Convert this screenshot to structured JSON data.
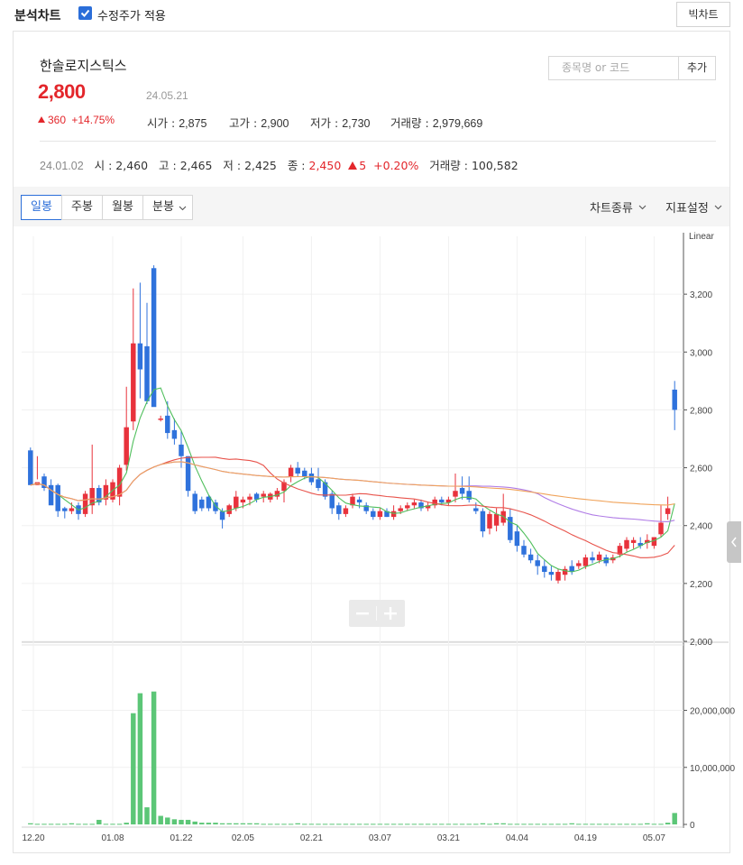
{
  "topbar": {
    "title": "분석차트",
    "adjusted_checkbox_label": "수정주가 적용",
    "adjusted_checked": true,
    "big_chart_button": "빅차트"
  },
  "stock": {
    "name": "한솔로지스틱스",
    "price": "2,800",
    "date": "24.05.21",
    "change": "360",
    "change_pct": "+14.75%",
    "open_label": "시가",
    "open": "2,875",
    "high_label": "고가",
    "high": "2,900",
    "low_label": "저가",
    "low": "2,730",
    "volume_label": "거래량",
    "volume": "2,979,669"
  },
  "search": {
    "placeholder": "종목명 or 코드",
    "add_button": "추가"
  },
  "hover": {
    "date": "24.01.02",
    "open_label": "시",
    "open": "2,460",
    "high_label": "고",
    "high": "2,465",
    "low_label": "저",
    "low": "2,425",
    "close_label": "종",
    "close": "2,450",
    "change": "5",
    "change_pct": "+0.20%",
    "volume_label": "거래량",
    "volume": "100,582"
  },
  "toolbar": {
    "periods": [
      "일봉",
      "주봉",
      "월봉",
      "분봉"
    ],
    "active_period": "일봉",
    "chart_type": "차트종류",
    "indicator_settings": "지표설정"
  },
  "colors": {
    "up": "#e8323c",
    "down": "#2f72dc",
    "volume": "#5cc677",
    "ma5": "#4fbf5c",
    "ma20": "#e8534b",
    "ma60": "#b07ce6",
    "ma120": "#f0a35a"
  },
  "chart_data": {
    "type": "candlestick",
    "scale_label": "Linear",
    "price_ticks": [
      2000,
      2200,
      2400,
      2600,
      2800,
      3000,
      3200
    ],
    "price_tick_labels": [
      "2,000",
      "2,200",
      "2,400",
      "2,600",
      "2,800",
      "3,000",
      "3,200"
    ],
    "volume_tick_labels": [
      "0",
      "10,000,000",
      "20,000,000"
    ],
    "volume_ticks": [
      0,
      10000000,
      20000000
    ],
    "x_tick_labels": [
      "12.20",
      "01.08",
      "01.22",
      "02.05",
      "02.21",
      "03.07",
      "03.21",
      "04.04",
      "04.19",
      "05.07"
    ],
    "candles": [
      [
        2660,
        2670,
        2560,
        2540
      ],
      [
        2540,
        2640,
        2560,
        2550
      ],
      [
        2570,
        2580,
        2520,
        2530
      ],
      [
        2540,
        2560,
        2530,
        2470
      ],
      [
        2540,
        2545,
        2430,
        2450
      ],
      [
        2460,
        2465,
        2425,
        2450
      ],
      [
        2450,
        2480,
        2440,
        2460
      ],
      [
        2470,
        2480,
        2420,
        2440
      ],
      [
        2440,
        2520,
        2430,
        2510
      ],
      [
        2470,
        2680,
        2440,
        2530
      ],
      [
        2530,
        2540,
        2470,
        2480
      ],
      [
        2490,
        2560,
        2470,
        2540
      ],
      [
        2490,
        2560,
        2480,
        2550
      ],
      [
        2500,
        2610,
        2470,
        2600
      ],
      [
        2610,
        2880,
        2590,
        2740
      ],
      [
        2760,
        3220,
        2730,
        3030
      ],
      [
        3030,
        3240,
        2840,
        2940
      ],
      [
        3020,
        3170,
        2820,
        2830
      ],
      [
        3290,
        3300,
        2870,
        2810
      ],
      [
        2770,
        2780,
        2760,
        2770
      ],
      [
        2780,
        2830,
        2700,
        2720
      ],
      [
        2730,
        2770,
        2680,
        2700
      ],
      [
        2680,
        2730,
        2600,
        2640
      ],
      [
        2640,
        2640,
        2500,
        2520
      ],
      [
        2510,
        2520,
        2440,
        2450
      ],
      [
        2490,
        2500,
        2450,
        2460
      ],
      [
        2500,
        2505,
        2450,
        2460
      ],
      [
        2480,
        2490,
        2440,
        2450
      ],
      [
        2450,
        2460,
        2390,
        2420
      ],
      [
        2440,
        2475,
        2430,
        2470
      ],
      [
        2460,
        2520,
        2450,
        2500
      ],
      [
        2480,
        2500,
        2460,
        2490
      ],
      [
        2490,
        2510,
        2470,
        2500
      ],
      [
        2510,
        2515,
        2480,
        2490
      ],
      [
        2500,
        2520,
        2480,
        2510
      ],
      [
        2490,
        2515,
        2480,
        2510
      ],
      [
        2500,
        2530,
        2490,
        2520
      ],
      [
        2520,
        2560,
        2480,
        2550
      ],
      [
        2570,
        2610,
        2550,
        2600
      ],
      [
        2600,
        2620,
        2570,
        2580
      ],
      [
        2590,
        2600,
        2560,
        2570
      ],
      [
        2580,
        2600,
        2540,
        2550
      ],
      [
        2560,
        2600,
        2520,
        2530
      ],
      [
        2550,
        2560,
        2490,
        2500
      ],
      [
        2510,
        2520,
        2440,
        2460
      ],
      [
        2470,
        2480,
        2420,
        2440
      ],
      [
        2440,
        2470,
        2430,
        2460
      ],
      [
        2470,
        2510,
        2460,
        2500
      ],
      [
        2490,
        2500,
        2460,
        2480
      ],
      [
        2470,
        2480,
        2440,
        2450
      ],
      [
        2450,
        2460,
        2420,
        2430
      ],
      [
        2430,
        2460,
        2420,
        2450
      ],
      [
        2450,
        2460,
        2430,
        2430
      ],
      [
        2430,
        2470,
        2420,
        2450
      ],
      [
        2450,
        2470,
        2440,
        2460
      ],
      [
        2460,
        2480,
        2450,
        2470
      ],
      [
        2470,
        2490,
        2460,
        2480
      ],
      [
        2480,
        2490,
        2450,
        2460
      ],
      [
        2460,
        2480,
        2450,
        2470
      ],
      [
        2470,
        2500,
        2460,
        2490
      ],
      [
        2490,
        2500,
        2470,
        2480
      ],
      [
        2480,
        2500,
        2470,
        2490
      ],
      [
        2500,
        2580,
        2480,
        2520
      ],
      [
        2530,
        2570,
        2490,
        2510
      ],
      [
        2520,
        2570,
        2480,
        2490
      ],
      [
        2460,
        2480,
        2440,
        2450
      ],
      [
        2450,
        2460,
        2360,
        2380
      ],
      [
        2390,
        2450,
        2370,
        2440
      ],
      [
        2400,
        2460,
        2380,
        2440
      ],
      [
        2410,
        2510,
        2400,
        2450
      ],
      [
        2430,
        2460,
        2340,
        2350
      ],
      [
        2380,
        2400,
        2310,
        2330
      ],
      [
        2330,
        2350,
        2290,
        2300
      ],
      [
        2300,
        2320,
        2270,
        2280
      ],
      [
        2280,
        2300,
        2230,
        2260
      ],
      [
        2260,
        2280,
        2220,
        2240
      ],
      [
        2240,
        2260,
        2210,
        2230
      ],
      [
        2210,
        2250,
        2200,
        2240
      ],
      [
        2230,
        2260,
        2210,
        2250
      ],
      [
        2260,
        2280,
        2230,
        2240
      ],
      [
        2260,
        2280,
        2250,
        2270
      ],
      [
        2260,
        2300,
        2250,
        2290
      ],
      [
        2290,
        2310,
        2270,
        2280
      ],
      [
        2280,
        2310,
        2270,
        2300
      ],
      [
        2290,
        2300,
        2260,
        2270
      ],
      [
        2280,
        2300,
        2270,
        2290
      ],
      [
        2300,
        2340,
        2290,
        2330
      ],
      [
        2320,
        2360,
        2310,
        2350
      ],
      [
        2340,
        2360,
        2320,
        2350
      ],
      [
        2340,
        2360,
        2320,
        2330
      ],
      [
        2340,
        2370,
        2320,
        2350
      ],
      [
        2330,
        2360,
        2320,
        2360
      ],
      [
        2370,
        2470,
        2360,
        2410
      ],
      [
        2440,
        2500,
        2420,
        2460
      ],
      [
        2870,
        2900,
        2730,
        2800
      ]
    ],
    "volumes": [
      0.2,
      0.1,
      0.1,
      0.1,
      0.1,
      0.1,
      0.2,
      0.1,
      0.1,
      0.1,
      0.8,
      0.1,
      0.1,
      0.1,
      0.3,
      19.5,
      23.0,
      3.0,
      23.3,
      1.5,
      1.2,
      0.9,
      0.8,
      0.8,
      0.5,
      0.3,
      0.3,
      0.3,
      0.2,
      0.2,
      0.2,
      0.2,
      0.2,
      0.2,
      0.1,
      0.1,
      0.1,
      0.1,
      0.1,
      0.2,
      0.1,
      0.1,
      0.1,
      0.1,
      0.1,
      0.1,
      0.1,
      0.1,
      0.1,
      0.1,
      0.1,
      0.1,
      0.1,
      0.1,
      0.1,
      0.1,
      0.1,
      0.1,
      0.1,
      0.1,
      0.1,
      0.1,
      0.1,
      0.1,
      0.1,
      0.1,
      0.2,
      0.1,
      0.2,
      0.2,
      0.1,
      0.1,
      0.1,
      0.1,
      0.1,
      0.1,
      0.1,
      0.1,
      0.1,
      0.2,
      0.1,
      0.1,
      0.1,
      0.1,
      0.1,
      0.1,
      0.1,
      0.1,
      0.1,
      0.1,
      0.2,
      0.1,
      0.1,
      0.3,
      2.0
    ],
    "volume_unit": "million"
  }
}
